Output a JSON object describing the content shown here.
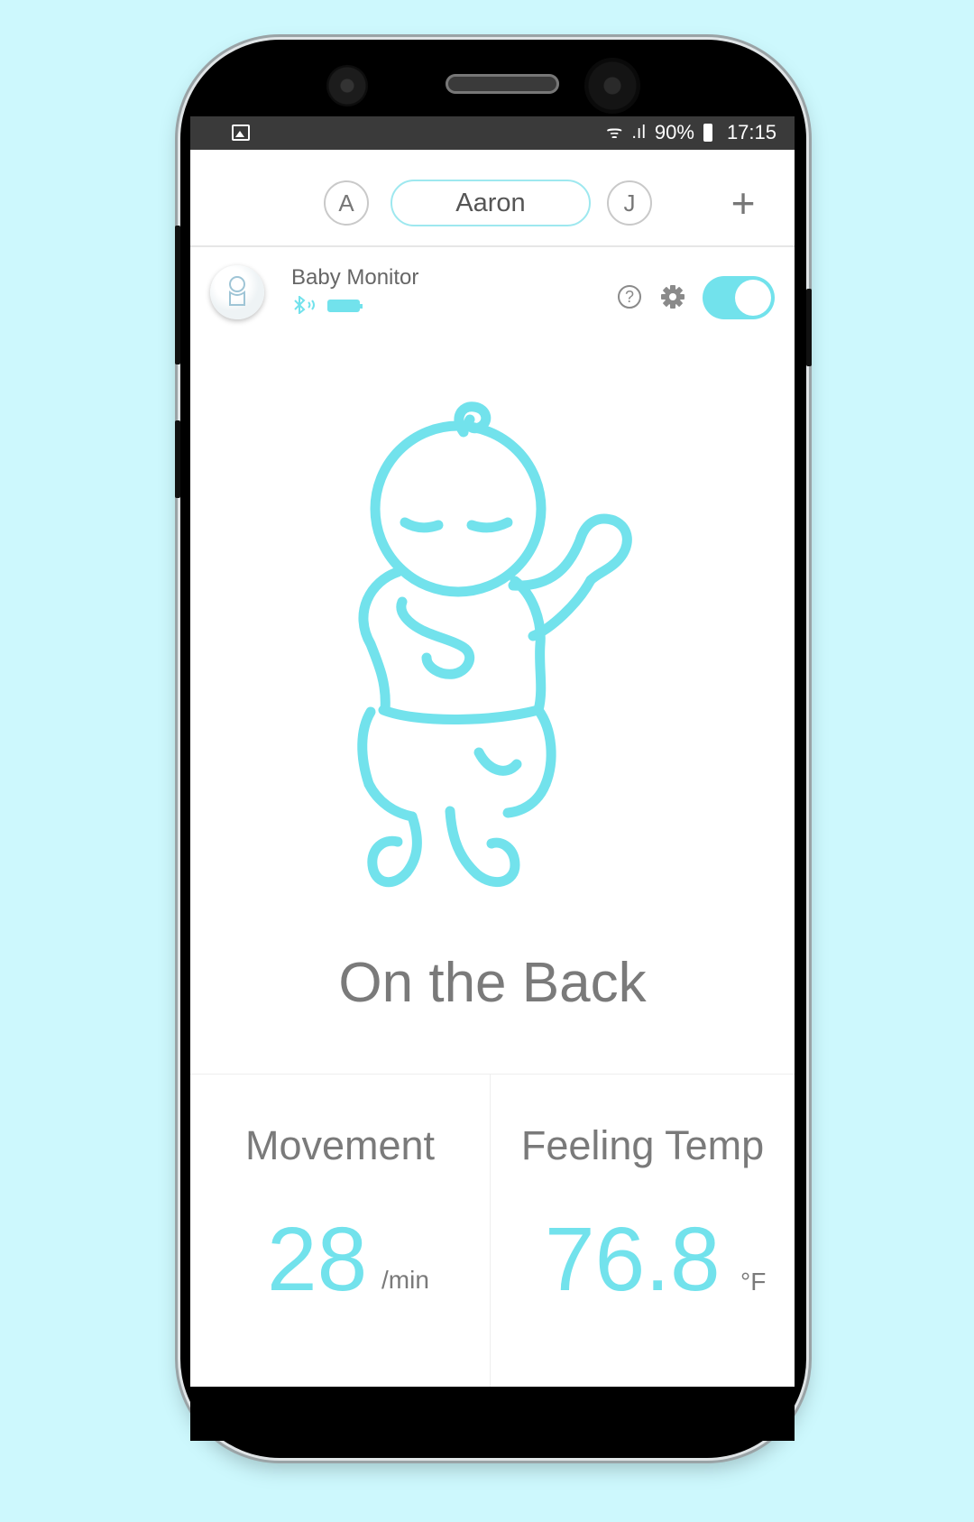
{
  "statusbar": {
    "wifi": "ᯤ",
    "signal": ".ıl",
    "battery": "90%",
    "time": "17:15"
  },
  "profiles": {
    "left_initial": "A",
    "active_name": "Aaron",
    "right_initial": "J",
    "add": "+"
  },
  "device": {
    "name": "Baby Monitor",
    "help": "?",
    "toggle_on": true
  },
  "status": {
    "posture": "On the Back"
  },
  "stats": {
    "movement": {
      "label": "Movement",
      "value": "28",
      "unit": "/min"
    },
    "temp": {
      "label": "Feeling Temp",
      "value": "76.8",
      "unit": "°F"
    }
  },
  "colors": {
    "accent": "#72e2ec",
    "background": "#cdf8fd",
    "text_gray": "#7a7a7a"
  }
}
